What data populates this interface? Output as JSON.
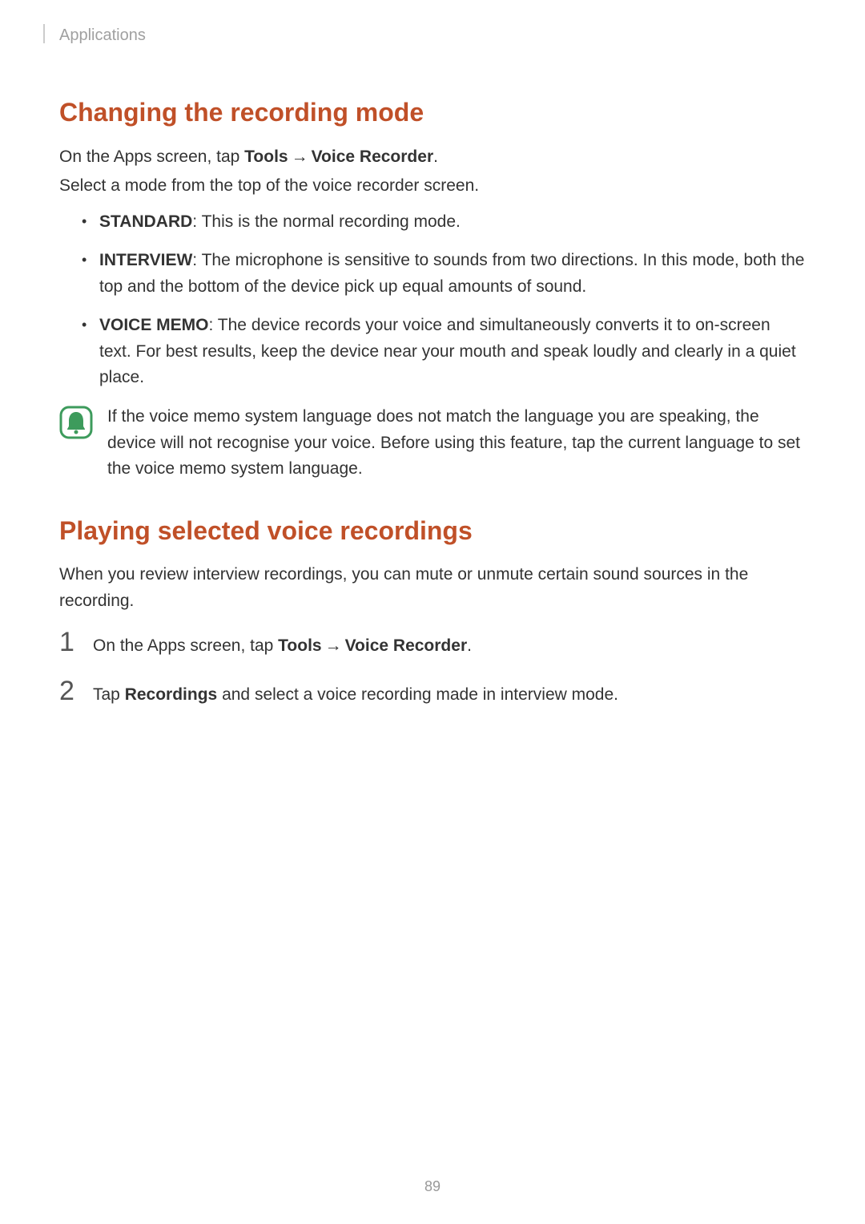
{
  "header": {
    "breadcrumb": "Applications"
  },
  "section1": {
    "title": "Changing the recording mode",
    "intro_pre": "On the Apps screen, tap ",
    "intro_tools": "Tools",
    "intro_arrow": "→",
    "intro_vr": "Voice Recorder",
    "intro_post": ".",
    "intro2": "Select a mode from the top of the voice recorder screen.",
    "bullets": {
      "b1_label": "STANDARD",
      "b1_text": ": This is the normal recording mode.",
      "b2_label": "INTERVIEW",
      "b2_text": ": The microphone is sensitive to sounds from two directions. In this mode, both the top and the bottom of the device pick up equal amounts of sound.",
      "b3_label": "VOICE MEMO",
      "b3_text": ": The device records your voice and simultaneously converts it to on-screen text. For best results, keep the device near your mouth and speak loudly and clearly in a quiet place."
    },
    "note": "If the voice memo system language does not match the language you are speaking, the device will not recognise your voice. Before using this feature, tap the current language to set the voice memo system language."
  },
  "section2": {
    "title": "Playing selected voice recordings",
    "intro": "When you review interview recordings, you can mute or unmute certain sound sources in the recording.",
    "steps": {
      "n1": "1",
      "s1_pre": "On the Apps screen, tap ",
      "s1_tools": "Tools",
      "s1_arrow": "→",
      "s1_vr": "Voice Recorder",
      "s1_post": ".",
      "n2": "2",
      "s2_pre": "Tap ",
      "s2_rec": "Recordings",
      "s2_post": " and select a voice recording made in interview mode."
    }
  },
  "page_number": "89"
}
